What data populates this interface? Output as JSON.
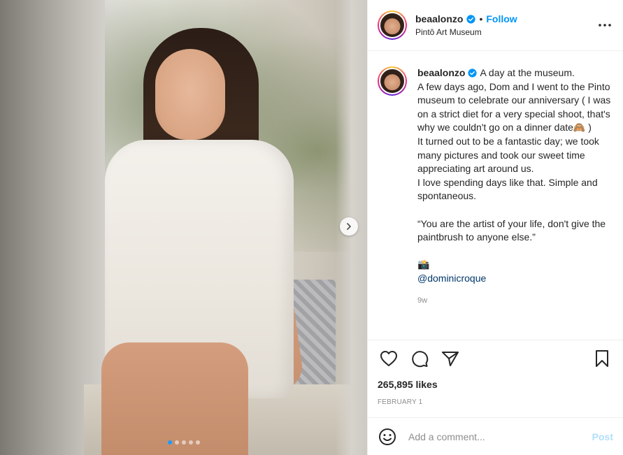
{
  "post": {
    "username": "beaalonzo",
    "follow_label": "Follow",
    "bullet": "•",
    "location": "Pintô Art Museum",
    "caption_lines": [
      "A day at the museum.",
      "A few days ago, Dom and I went to the Pinto museum to celebrate our anniversary ( I was on a strict diet for a very special shoot, that's why we couldn't go on a dinner date🙈 )",
      "It turned out to be a fantastic day; we took many pictures and took our sweet time appreciating art around us.",
      "I love spending days like that. Simple and spontaneous.",
      "",
      "“You are the artist of your life, don't give the paintbrush to anyone else.”",
      "",
      "📸"
    ],
    "mention": "@dominicroque",
    "time_ago": "9w",
    "likes": "265,895 likes",
    "date": "FEBRUARY 1",
    "comment_placeholder": "Add a comment...",
    "post_label": "Post",
    "carousel": {
      "count": 5,
      "active_index": 0
    }
  },
  "colors": {
    "accent": "#0095f6",
    "post_disabled": "#b2dffc",
    "muted": "#8e8e8e",
    "text": "#262626"
  },
  "icons": [
    "verified-icon",
    "more-options-icon",
    "heart-icon",
    "comment-icon",
    "share-icon",
    "bookmark-icon",
    "emoji-icon",
    "chevron-right-icon"
  ]
}
